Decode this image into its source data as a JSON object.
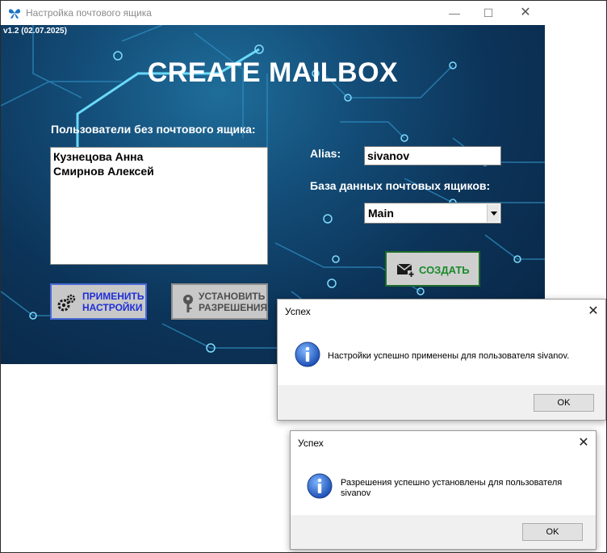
{
  "window": {
    "title": "Настройка почтового ящика",
    "minimize_glyph": "—",
    "maximize_glyph": "☐",
    "close_glyph": "✕",
    "icon": "app-butterfly-icon"
  },
  "main": {
    "version": "v1.2 (02.07.2025)",
    "heading": "CREATE MAILBOX",
    "users_label": "Пользователи без почтового ящика:",
    "users": [
      "Кузнецова Анна",
      "Смирнов Алексей"
    ],
    "alias_label": "Alias:",
    "alias_value": "sivanov",
    "db_label": "База данных почтовых ящиков:",
    "db_selected": "Main",
    "create_button": {
      "label": "СОЗДАТЬ",
      "icon": "mail-add-icon"
    },
    "apply_button": {
      "line1": "ПРИМЕНИТЬ",
      "line2": "НАСТРОЙКИ",
      "icon": "gears-icon"
    },
    "permissions_button": {
      "line1": "УСТАНОВИТЬ",
      "line2": "РАЗРЕШЕНИЯ",
      "icon": "key-icon"
    }
  },
  "dialogs": [
    {
      "title": "Успех",
      "message": "Настройки успешно применены для пользователя sivanov.",
      "ok_label": "OK",
      "close_glyph": "✕",
      "icon": "info-icon"
    },
    {
      "title": "Успех",
      "message": "Разрешения успешно установлены для пользователя sivanov",
      "ok_label": "OK",
      "close_glyph": "✕",
      "icon": "info-icon"
    }
  ],
  "colors": {
    "window_bg": "#0b2a4a",
    "create_text": "#1a8a2a",
    "apply_text": "#1f2fd6",
    "apply_border": "#4a6bd6",
    "create_border": "#1e6b2a",
    "circuit": "#5fd3f0"
  }
}
